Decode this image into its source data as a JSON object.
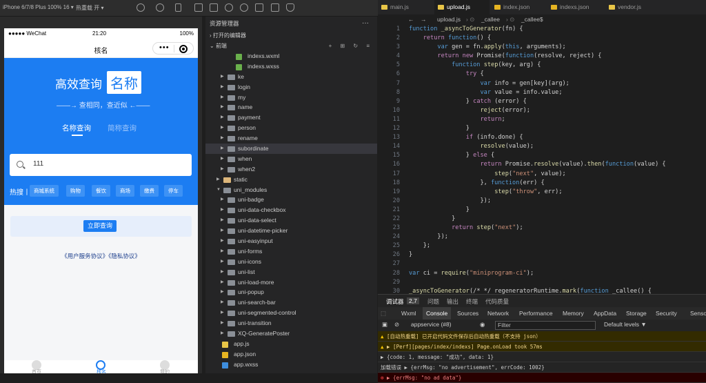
{
  "toolbar": {
    "device": "iPhone 6/7/8 Plus 100% 16 ▾",
    "hot_reload": "热重载 开 ▾"
  },
  "phone": {
    "status": {
      "carrier": "●●●●● WeChat",
      "time": "21:20",
      "battery": "100%"
    },
    "nav_title": "核名",
    "hero": {
      "title_a": "高效查询",
      "title_b": "名称",
      "subtitle": "——→ 查相同，查近似 ←——",
      "tab_name": "名称查询",
      "tab_abbr": "简称查询"
    },
    "search_value": "111",
    "hot_label": "热搜丨",
    "tags": [
      "商城系统",
      "购物",
      "餐饮",
      "商场",
      "缴费",
      "停车"
    ],
    "query_button": "立即查询",
    "agreement": "《用户服务协议》《隐私协议》",
    "tabbar": [
      "首页",
      "核名",
      "我的"
    ]
  },
  "explorer": {
    "title": "资源管理器",
    "menu": "···",
    "open_editors": "打开的编辑器",
    "project": "前端",
    "rows": [
      {
        "label": "indexs.wxml",
        "kind": "file",
        "depth": 3
      },
      {
        "label": "indexs.wxss",
        "kind": "file",
        "depth": 3
      },
      {
        "label": "ke",
        "kind": "folder",
        "depth": 2
      },
      {
        "label": "login",
        "kind": "folder",
        "depth": 2
      },
      {
        "label": "my",
        "kind": "folder",
        "depth": 2
      },
      {
        "label": "name",
        "kind": "folder",
        "depth": 2
      },
      {
        "label": "payment",
        "kind": "folder",
        "depth": 2
      },
      {
        "label": "person",
        "kind": "folder",
        "depth": 2
      },
      {
        "label": "rename",
        "kind": "folder",
        "depth": 2
      },
      {
        "label": "subordinate",
        "kind": "folder",
        "depth": 2
      },
      {
        "label": "when",
        "kind": "folder",
        "depth": 2
      },
      {
        "label": "when2",
        "kind": "folder",
        "depth": 2
      },
      {
        "label": "static",
        "kind": "folder",
        "depth": 1
      },
      {
        "label": "uni_modules",
        "kind": "folder-open",
        "depth": 1
      },
      {
        "label": "uni-badge",
        "kind": "folder",
        "depth": 2
      },
      {
        "label": "uni-data-checkbox",
        "kind": "folder",
        "depth": 2
      },
      {
        "label": "uni-data-select",
        "kind": "folder",
        "depth": 2
      },
      {
        "label": "uni-datetime-picker",
        "kind": "folder",
        "depth": 2
      },
      {
        "label": "uni-easyinput",
        "kind": "folder",
        "depth": 2
      },
      {
        "label": "uni-forms",
        "kind": "folder",
        "depth": 2
      },
      {
        "label": "uni-icons",
        "kind": "folder",
        "depth": 2
      },
      {
        "label": "uni-list",
        "kind": "folder",
        "depth": 2
      },
      {
        "label": "uni-load-more",
        "kind": "folder",
        "depth": 2
      },
      {
        "label": "uni-popup",
        "kind": "folder",
        "depth": 2
      },
      {
        "label": "uni-search-bar",
        "kind": "folder",
        "depth": 2
      },
      {
        "label": "uni-segmented-control",
        "kind": "folder",
        "depth": 2
      },
      {
        "label": "uni-transition",
        "kind": "folder",
        "depth": 2
      },
      {
        "label": "XQ-GeneratePoster",
        "kind": "folder",
        "depth": 2
      },
      {
        "label": "app.js",
        "kind": "js",
        "depth": 1
      },
      {
        "label": "app.json",
        "kind": "json",
        "depth": 1
      },
      {
        "label": "app.wxss",
        "kind": "wxss",
        "depth": 1
      }
    ]
  },
  "editor": {
    "tabs": [
      "main.js",
      "upload.js",
      "index.json",
      "indexs.json",
      "vendor.js"
    ],
    "breadcrumb": [
      "upload.js",
      "_callee",
      "_callee$"
    ],
    "lines": [
      {
        "n": "1",
        "code": "function _asyncToGenerator(fn) {"
      },
      {
        "n": "2",
        "code": "    return function() {"
      },
      {
        "n": "3",
        "code": "        var gen = fn.apply(this, arguments);"
      },
      {
        "n": "4",
        "code": "        return new Promise(function(resolve, reject) {"
      },
      {
        "n": "5",
        "code": "            function step(key, arg) {"
      },
      {
        "n": "6",
        "code": "                try {"
      },
      {
        "n": "7",
        "code": "                    var info = gen[key](arg);"
      },
      {
        "n": "8",
        "code": "                    var value = info.value;"
      },
      {
        "n": "9",
        "code": "                } catch (error) {"
      },
      {
        "n": "10",
        "code": "                    reject(error);"
      },
      {
        "n": "11",
        "code": "                    return;"
      },
      {
        "n": "12",
        "code": "                }"
      },
      {
        "n": "13",
        "code": "                if (info.done) {"
      },
      {
        "n": "14",
        "code": "                    resolve(value);"
      },
      {
        "n": "15",
        "code": "                } else {"
      },
      {
        "n": "16",
        "code": "                    return Promise.resolve(value).then(function(value) {"
      },
      {
        "n": "17",
        "code": "                        step(\"next\", value);"
      },
      {
        "n": "18",
        "code": "                    }, function(err) {"
      },
      {
        "n": "19",
        "code": "                        step(\"throw\", err);"
      },
      {
        "n": "20",
        "code": "                    });"
      },
      {
        "n": "21",
        "code": "                }"
      },
      {
        "n": "22",
        "code": "            }"
      },
      {
        "n": "23",
        "code": "            return step(\"next\");"
      },
      {
        "n": "24",
        "code": "        });"
      },
      {
        "n": "25",
        "code": "    };"
      },
      {
        "n": "26",
        "code": "}"
      },
      {
        "n": "27",
        "code": ""
      },
      {
        "n": "28",
        "code": "var ci = require(\"miniprogram-ci\");"
      },
      {
        "n": "29",
        "code": ""
      },
      {
        "n": "30",
        "code": "_asyncToGenerator(/* */ regeneratorRuntime.mark(function _callee() {"
      }
    ]
  },
  "console": {
    "top_tabs": [
      "调试器",
      "2,7",
      "问题",
      "输出",
      "终端",
      "代码质量"
    ],
    "dev_tabs": [
      "Wxml",
      "Console",
      "Sources",
      "Network",
      "Performance",
      "Memory",
      "AppData",
      "Storage",
      "Security",
      "Sensor"
    ],
    "context": "appservice (#8)",
    "filter_placeholder": "Filter",
    "levels": "Default levels ▼",
    "logs": [
      {
        "level": "warn",
        "text": "[自动热重载] 已开启代码文件保存后自动热重载（不支持 json）"
      },
      {
        "level": "warn",
        "text": "▶ [Perf][pages/index/indexs] Page.onLoad took 57ms"
      },
      {
        "level": "info",
        "text": "▶ {code: 1, message: \"成功\", data: 1}"
      },
      {
        "level": "info",
        "text": "加载错误 ▶ {errMsg: \"no advertisement\", errCode: 1002}"
      },
      {
        "level": "error",
        "text": "▶ {errMsg: \"no ad data\"}"
      }
    ]
  }
}
